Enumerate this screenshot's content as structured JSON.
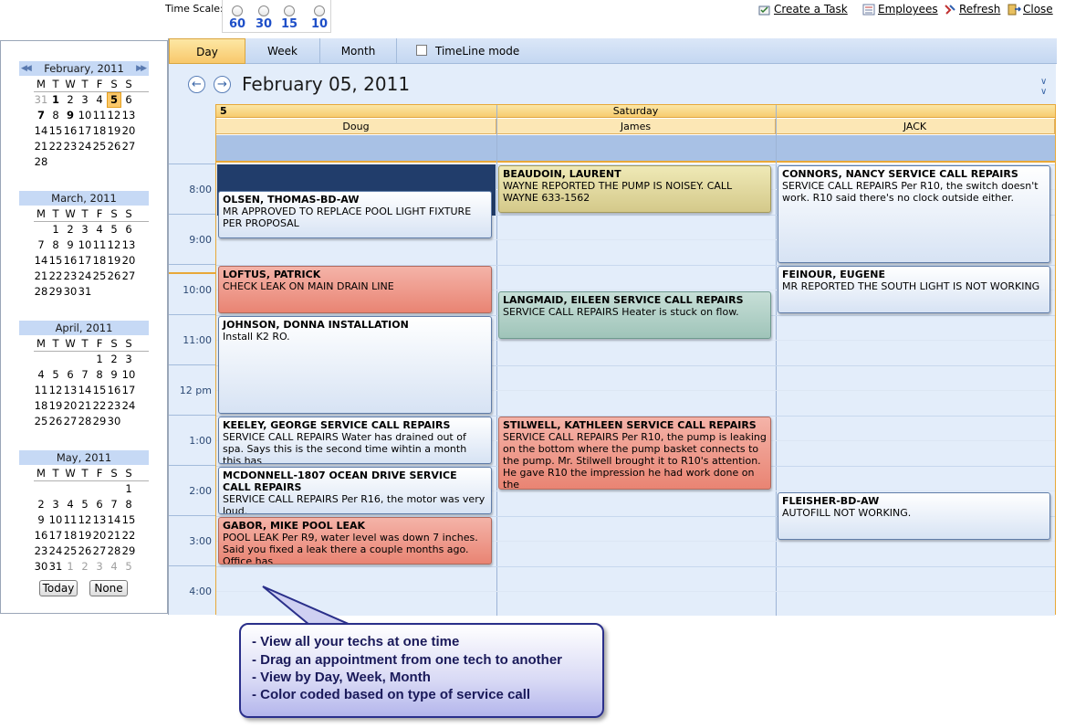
{
  "toolbar": {
    "time_scale_label": "Time Scale:",
    "time_scales": [
      "60",
      "30",
      "15",
      "10"
    ],
    "create_task": "Create a Task",
    "employees": "Employees",
    "refresh": "Refresh",
    "close": "Close"
  },
  "mini_calendars": [
    {
      "title": "February, 2011",
      "dow": [
        "M",
        "T",
        "W",
        "T",
        "F",
        "S",
        "S"
      ],
      "days": [
        "31",
        "1",
        "2",
        "3",
        "4",
        "5",
        "6",
        "7",
        "8",
        "9",
        "10",
        "11",
        "12",
        "13",
        "14",
        "15",
        "16",
        "17",
        "18",
        "19",
        "20",
        "21",
        "22",
        "23",
        "24",
        "25",
        "26",
        "27",
        "28"
      ],
      "offset": 0,
      "selected": "5",
      "gray": [
        "31"
      ],
      "bold": [
        "1",
        "5",
        "7",
        "9"
      ]
    },
    {
      "title": "March, 2011",
      "dow": [
        "M",
        "T",
        "W",
        "T",
        "F",
        "S",
        "S"
      ],
      "days": [
        "1",
        "2",
        "3",
        "4",
        "5",
        "6",
        "7",
        "8",
        "9",
        "10",
        "11",
        "12",
        "13",
        "14",
        "15",
        "16",
        "17",
        "18",
        "19",
        "20",
        "21",
        "22",
        "23",
        "24",
        "25",
        "26",
        "27",
        "28",
        "29",
        "30",
        "31"
      ],
      "offset": 1
    },
    {
      "title": "April, 2011",
      "dow": [
        "M",
        "T",
        "W",
        "T",
        "F",
        "S",
        "S"
      ],
      "days": [
        "1",
        "2",
        "3",
        "4",
        "5",
        "6",
        "7",
        "8",
        "9",
        "10",
        "11",
        "12",
        "13",
        "14",
        "15",
        "16",
        "17",
        "18",
        "19",
        "20",
        "21",
        "22",
        "23",
        "24",
        "25",
        "26",
        "27",
        "28",
        "29",
        "30"
      ],
      "offset": 4
    },
    {
      "title": "May, 2011",
      "dow": [
        "M",
        "T",
        "W",
        "T",
        "F",
        "S",
        "S"
      ],
      "days": [
        "1",
        "2",
        "3",
        "4",
        "5",
        "6",
        "7",
        "8",
        "9",
        "10",
        "11",
        "12",
        "13",
        "14",
        "15",
        "16",
        "17",
        "18",
        "19",
        "20",
        "21",
        "22",
        "23",
        "24",
        "25",
        "26",
        "27",
        "28",
        "29",
        "30",
        "31",
        "1",
        "2",
        "3",
        "4",
        "5"
      ],
      "offset": 6,
      "trailing_gray": 5
    }
  ],
  "buttons": {
    "today": "Today",
    "none": "None"
  },
  "tabs": {
    "day": "Day",
    "week": "Week",
    "month": "Month",
    "timeline": "TimeLine mode"
  },
  "date_title": "February 05, 2011",
  "day_header": {
    "num": "5",
    "name": "Saturday"
  },
  "resources": [
    "Doug",
    "James",
    "JACK"
  ],
  "times": [
    "8:00",
    "9:00",
    "10:00",
    "11:00",
    "12 pm",
    "1:00",
    "2:00",
    "3:00",
    "4:00"
  ],
  "appointments": [
    {
      "col": 0,
      "title": "OLSEN, THOMAS-BD-AW",
      "desc": "MR APPROVED TO REPLACE POOL LIGHT FIXTURE PER PROPOSAL",
      "color": "blue",
      "start": 0.5,
      "end": 1.5
    },
    {
      "col": 0,
      "title": "LOFTUS, PATRICK",
      "desc": "CHECK LEAK ON MAIN DRAIN LINE",
      "color": "red",
      "start": 2,
      "end": 3
    },
    {
      "col": 0,
      "title": "JOHNSON, DONNA INSTALLATION",
      "desc": "Install K2 RO.",
      "color": "blue",
      "start": 3,
      "end": 5
    },
    {
      "col": 0,
      "title": "KEELEY, GEORGE SERVICE CALL REPAIRS",
      "desc": "SERVICE CALL REPAIRS  Water has drained out of spa. Says this is the second time wihtin a month this has",
      "color": "blue",
      "start": 5,
      "end": 6
    },
    {
      "col": 0,
      "title": "MCDONNELL-1807 OCEAN DRIVE SERVICE CALL REPAIRS",
      "desc": "SERVICE CALL REPAIRS  Per R16, the motor was very loud.",
      "color": "blue",
      "start": 6,
      "end": 7
    },
    {
      "col": 0,
      "title": "GABOR, MIKE POOL LEAK",
      "desc": "POOL LEAK  Per R9, water level was down 7 inches. Said you fixed a leak there a couple months ago.  Office has",
      "color": "red",
      "start": 7,
      "end": 8
    },
    {
      "col": 1,
      "title": "BEAUDOIN, LAURENT",
      "desc": "WAYNE REPORTED THE PUMP IS NOISEY. CALL WAYNE 633-1562",
      "color": "olive",
      "start": 0,
      "end": 1
    },
    {
      "col": 1,
      "title": "LANGMAID, EILEEN SERVICE CALL REPAIRS",
      "desc": "SERVICE CALL REPAIRS  Heater is stuck on flow.",
      "color": "teal",
      "start": 2.5,
      "end": 3.5
    },
    {
      "col": 1,
      "title": "STILWELL, KATHLEEN SERVICE CALL REPAIRS",
      "desc": "SERVICE CALL REPAIRS  Per R10, the pump is leaking on the bottom where the pump basket connects to the pump.  Mr. Stilwell brought it to R10's attention.  He gave R10 the impression he had work done on the",
      "color": "red",
      "start": 5,
      "end": 6.5
    },
    {
      "col": 2,
      "title": "CONNORS, NANCY SERVICE CALL REPAIRS",
      "desc": "SERVICE CALL REPAIRS  Per R10, the switch doesn't work. R10 said there's no clock outside either.",
      "color": "blue",
      "start": 0,
      "end": 2
    },
    {
      "col": 2,
      "title": "FEINOUR, EUGENE",
      "desc": "MR REPORTED THE SOUTH LIGHT IS NOT WORKING",
      "color": "blue",
      "start": 2,
      "end": 3
    },
    {
      "col": 2,
      "title": "FLEISHER-BD-AW",
      "desc": "AUTOFILL NOT WORKING.",
      "color": "blue",
      "start": 6.5,
      "end": 7.5
    }
  ],
  "callout": [
    "- View all your techs at one time",
    "- Drag an appointment from one tech to another",
    "- View by Day, Week, Month",
    "- Color coded based on type of service call"
  ],
  "icons": {
    "create_task": "task-icon",
    "employees": "employees-icon",
    "refresh": "refresh-icon",
    "close": "close-icon",
    "prev": "arrow-left-icon",
    "next": "arrow-right-icon",
    "collapse": "chevron-double-down-icon"
  }
}
